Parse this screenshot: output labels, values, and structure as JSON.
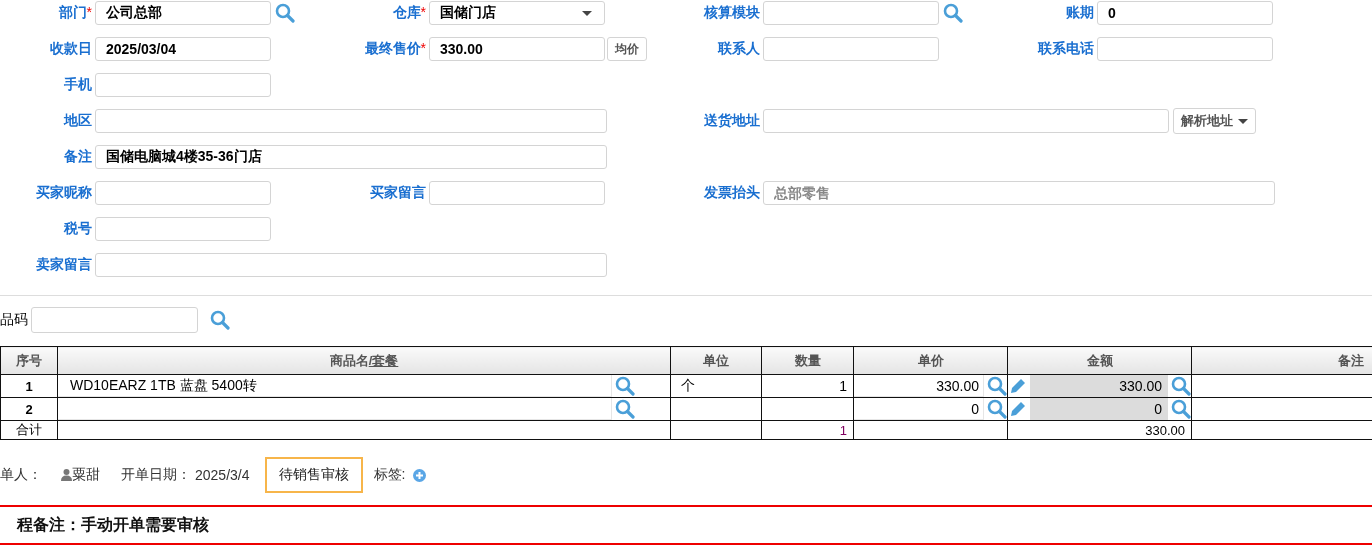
{
  "form": {
    "rows": [
      [
        {
          "label": "部门",
          "required_mark": "*",
          "value": "公司总部",
          "kind": "lookup"
        },
        {
          "label": "仓库",
          "required_mark": "*",
          "value": "国储门店",
          "kind": "select"
        },
        {
          "label": "核算模块",
          "kind": "lookup"
        },
        {
          "label": "账期",
          "value": "0",
          "kind": "text"
        }
      ],
      [
        {
          "label": "收款日",
          "value": "2025/03/04",
          "kind": "text"
        },
        {
          "label": "最终售价",
          "required_mark": "*",
          "value": "330.00",
          "kind": "text",
          "button": "均价"
        },
        {
          "label": "联系人",
          "kind": "text"
        },
        {
          "label": "联系电话",
          "kind": "text"
        }
      ],
      [
        {
          "label": "手机",
          "kind": "text"
        }
      ],
      [
        {
          "label": "地区",
          "kind": "wide"
        },
        "",
        {
          "label": "送货地址",
          "kind": "wide",
          "button": "解析地址"
        }
      ],
      [
        {
          "label": "备注",
          "value": "国储电脑城4楼35-36门店",
          "kind": "wide"
        }
      ],
      [
        {
          "label": "买家昵称",
          "kind": "text"
        },
        {
          "label": "买家留言",
          "kind": "text"
        },
        {
          "label": "发票抬头",
          "placeholder": "总部零售",
          "kind": "wide"
        }
      ],
      [
        {
          "label": "税号",
          "kind": "text"
        }
      ],
      [
        {
          "label": "卖家留言",
          "kind": "wide"
        }
      ]
    ]
  },
  "code_search": {
    "label": "品码"
  },
  "table": {
    "columns": [
      {
        "label": "序号"
      },
      {
        "label": "商品名",
        "link": "/套餐"
      },
      {
        "label": "单位"
      },
      {
        "label": "数量"
      },
      {
        "label": "单价"
      },
      {
        "label": "金额"
      },
      {
        "label": "备注"
      }
    ],
    "rows": [
      {
        "index": "1",
        "name": "WD10EARZ 1TB 蓝盘 5400转",
        "unit": "个",
        "qty": "1",
        "price": "330.00",
        "amount": "330.00"
      },
      {
        "index": "2",
        "price": "0",
        "amount": "0"
      }
    ],
    "totals": {
      "label": "合计",
      "qty": "1",
      "amount": "330.00"
    }
  },
  "footer": {
    "creator_label": "单人：",
    "creator": "粟甜",
    "date_label": "开单日期：",
    "date": "2025/3/4",
    "status": "待销售审核",
    "tags_label": "标签:"
  },
  "process_note": "程备注：手动开单需要审核"
}
